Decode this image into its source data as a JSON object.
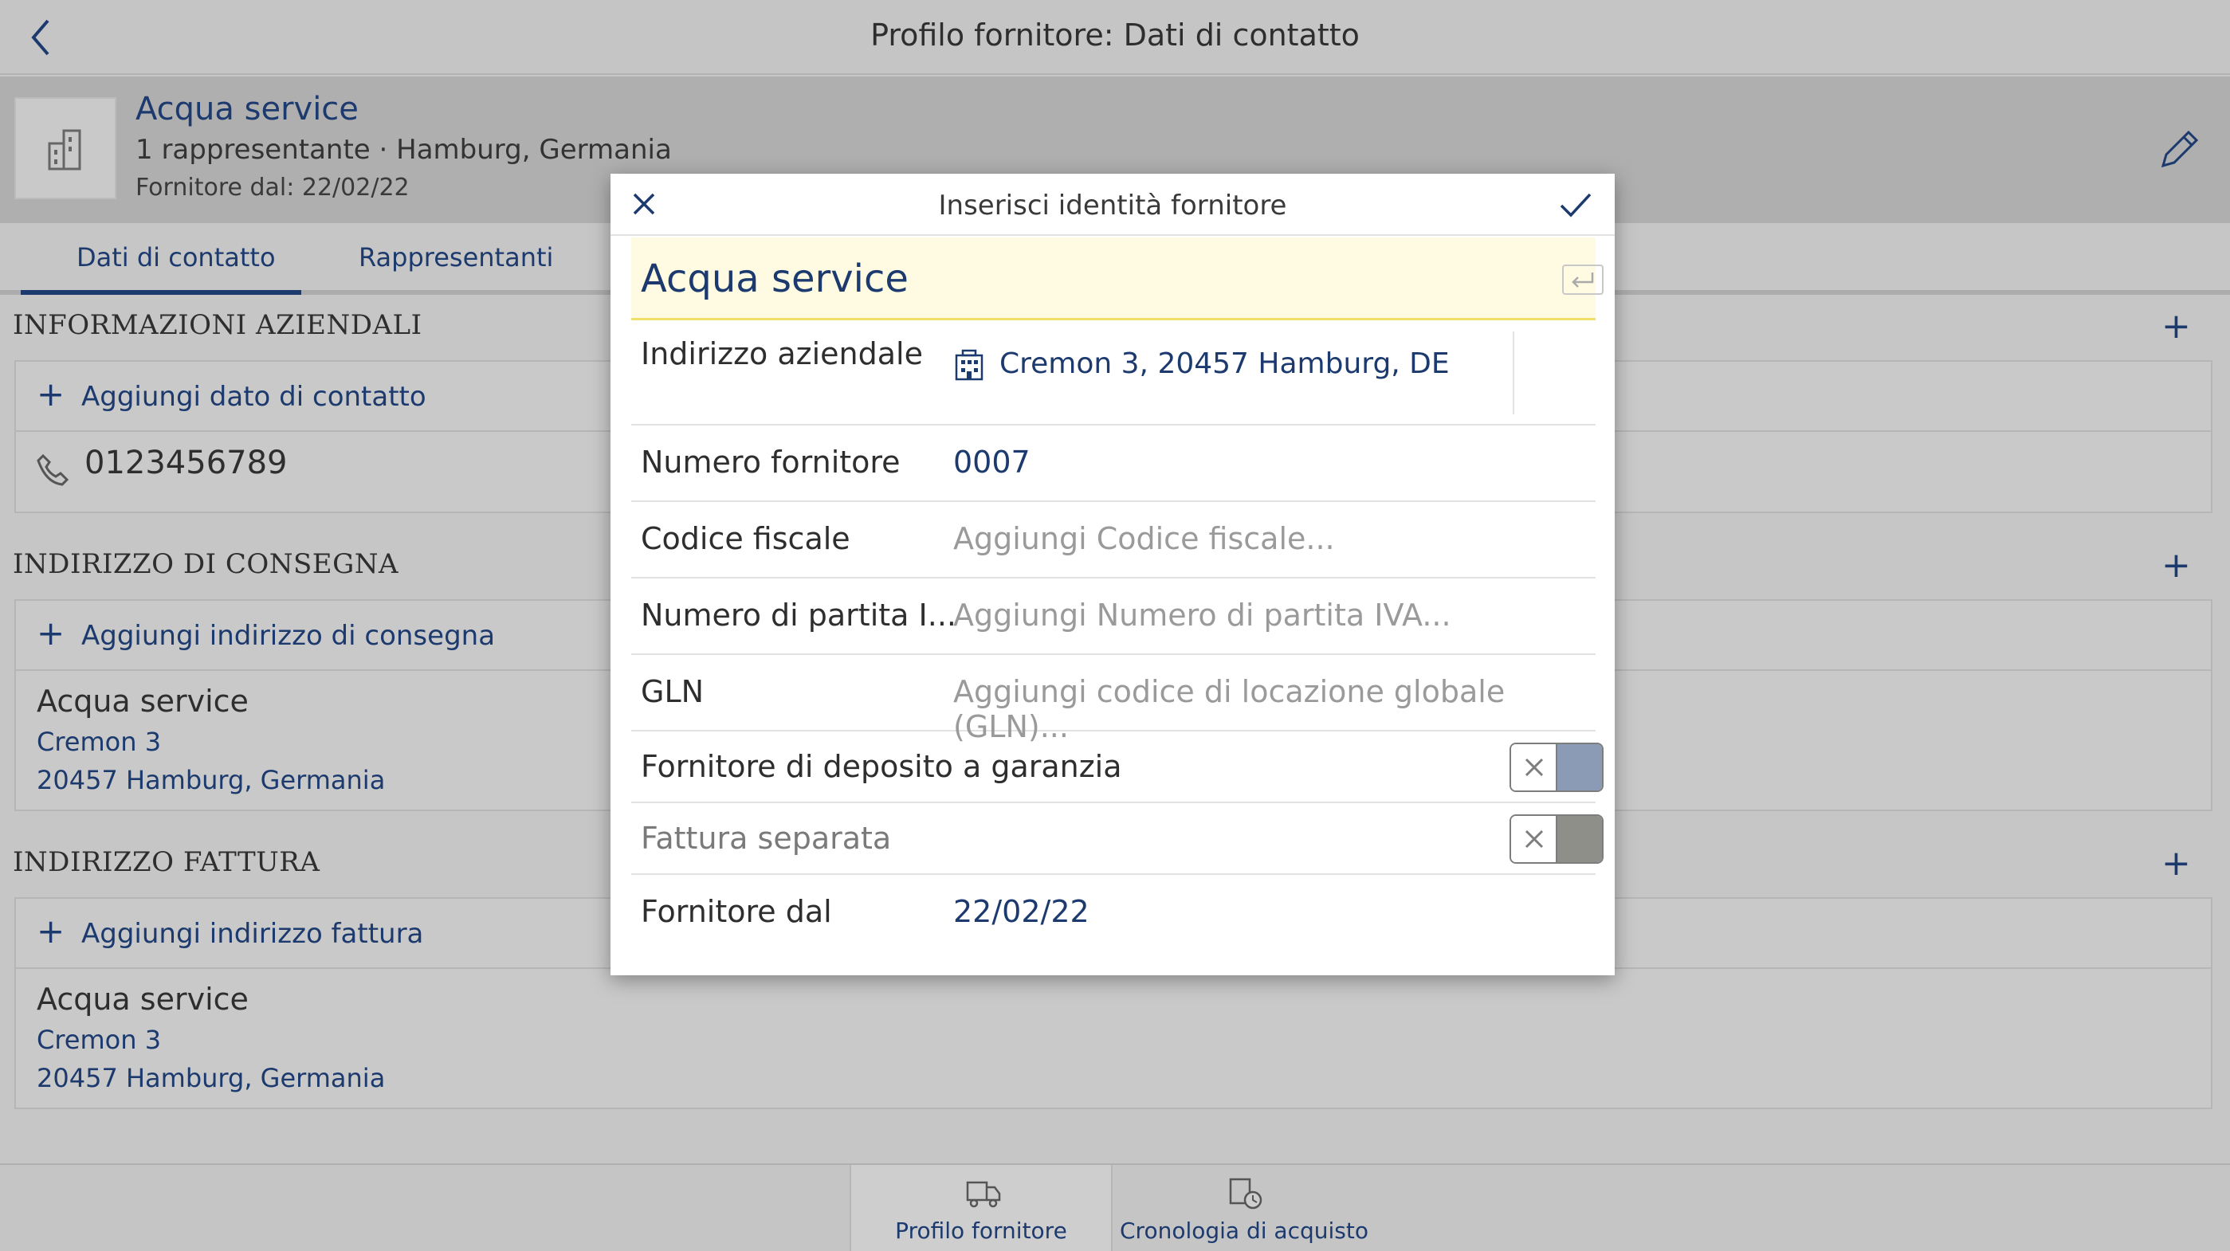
{
  "topbar": {
    "title": "Profilo fornitore: Dati di contatto"
  },
  "header": {
    "name": "Acqua service",
    "subtitle": "1 rappresentante · Hamburg, Germania",
    "since": "Fornitore dal: 22/02/22"
  },
  "tabs": [
    {
      "label": "Dati di contatto",
      "active": true
    },
    {
      "label": "Rappresentanti",
      "active": false
    }
  ],
  "sections": {
    "business": {
      "title": "INFORMAZIONI AZIENDALI",
      "add_label": "Aggiungi dato di contatto",
      "phone": "0123456789"
    },
    "delivery": {
      "title": "INDIRIZZO DI CONSEGNA",
      "add_label": "Aggiungi indirizzo di consegna",
      "name": "Acqua service",
      "street": "Cremon 3",
      "city": "20457 Hamburg, Germania"
    },
    "invoice": {
      "title": "INDIRIZZO FATTURA",
      "add_label": "Aggiungi indirizzo fattura",
      "name": "Acqua service",
      "street": "Cremon 3",
      "city": "20457 Hamburg, Germania"
    }
  },
  "bottombar": {
    "items": [
      {
        "label": "Profilo fornitore",
        "active": true
      },
      {
        "label": "Cronologia di acquisto",
        "active": false
      }
    ]
  },
  "dialog": {
    "title": "Inserisci identità fornitore",
    "name_value": "Acqua service",
    "fields": {
      "address_label": "Indirizzo aziendale",
      "address_value": "Cremon 3, 20457 Hamburg, DE",
      "supplier_number_label": "Numero fornitore",
      "supplier_number_value": "0007",
      "tax_code_label": "Codice fiscale",
      "tax_code_placeholder": "Aggiungi Codice fiscale...",
      "vat_label": "Numero di partita I...",
      "vat_placeholder": "Aggiungi Numero di partita IVA...",
      "gln_label": "GLN",
      "gln_placeholder": "Aggiungi codice di locazione globale (GLN)...",
      "deposit_label": "Fornitore di deposito a garanzia",
      "deposit_on": false,
      "separate_invoice_label": "Fattura separata",
      "separate_invoice_on": false,
      "since_label": "Fornitore dal",
      "since_value": "22/02/22"
    },
    "colors": {
      "accent": "#1c3a6e",
      "toggle_blue": "#8c9bb5",
      "toggle_gray": "#8f8f8a"
    }
  }
}
